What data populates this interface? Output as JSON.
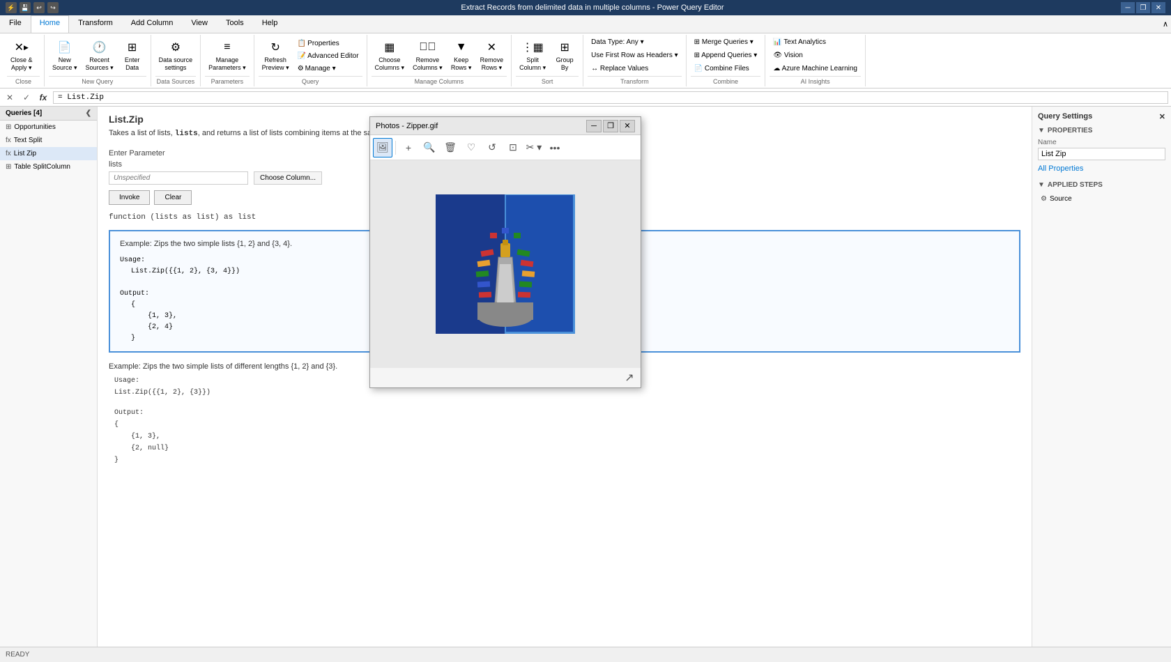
{
  "titlebar": {
    "title": "Extract Records from delimited data in multiple columns - Power Query Editor",
    "icons": [
      "save",
      "undo",
      "redo"
    ],
    "controls": [
      "minimize",
      "restore",
      "close"
    ]
  },
  "ribbon": {
    "tabs": [
      "File",
      "Home",
      "Transform",
      "Add Column",
      "View",
      "Tools",
      "Help"
    ],
    "active_tab": "Home",
    "groups": {
      "close": {
        "label": "Close",
        "buttons": [
          {
            "label": "Close &\nApply",
            "icon": "✕"
          }
        ]
      },
      "query": {
        "label": "New Query",
        "buttons": [
          {
            "label": "New\nSource",
            "icon": "📄"
          },
          {
            "label": "Recent\nSources",
            "icon": "🕐"
          },
          {
            "label": "Enter\nData",
            "icon": "📊"
          }
        ]
      },
      "data_sources": {
        "label": "Data Sources",
        "buttons": [
          {
            "label": "Data source\nsettings",
            "icon": "⚙"
          }
        ]
      },
      "parameters": {
        "label": "Parameters",
        "buttons": [
          {
            "label": "Manage\nParameters",
            "icon": "≡"
          }
        ]
      },
      "query_group": {
        "label": "Query",
        "buttons": [
          {
            "label": "Refresh\nPreview",
            "icon": "↻"
          },
          {
            "label": "Manage ▾",
            "icon": ""
          }
        ]
      },
      "manage_columns": {
        "label": "Manage Columns",
        "buttons": [
          {
            "label": "Choose\nColumns",
            "icon": "▦"
          },
          {
            "label": "Remove\nColumns",
            "icon": "✕"
          },
          {
            "label": "Keep\nRows",
            "icon": "≡"
          },
          {
            "label": "Remove\nRows",
            "icon": "≡"
          }
        ]
      },
      "sort": {
        "label": "Sort",
        "buttons": [
          {
            "label": "Split\nColumn",
            "icon": "⋮"
          },
          {
            "label": "Group\nBy",
            "icon": "⊞"
          }
        ]
      },
      "transform": {
        "label": "Transform",
        "items": [
          "Data Type: Any ▾",
          "Use First Row as Headers ▾",
          "Replace Values"
        ]
      },
      "combine": {
        "label": "Combine",
        "items": [
          "Merge Queries ▾",
          "Append Queries ▾",
          "Combine Files"
        ]
      },
      "ai_insights": {
        "label": "AI Insights",
        "items": [
          "Text Analytics",
          "Vision",
          "Azure Machine Learning"
        ]
      }
    }
  },
  "formula_bar": {
    "check_label": "✓",
    "x_label": "✕",
    "fx_label": "fx",
    "value": "= List.Zip"
  },
  "sidebar": {
    "header": "Queries [4]",
    "items": [
      {
        "label": "Opportunities",
        "icon": "⊞",
        "active": false
      },
      {
        "label": "Text Split",
        "icon": "fx",
        "active": false
      },
      {
        "label": "List Zip",
        "icon": "fx",
        "active": true
      },
      {
        "label": "Table SplitColumn",
        "icon": "⊞",
        "active": false
      }
    ]
  },
  "content": {
    "title": "List.Zip",
    "description": "Takes a list of lists, lists, and returns a list of lists combining items at the same position.",
    "description_code": "lists",
    "param_section": {
      "label": "Enter Parameter",
      "param_name": "lists",
      "param_placeholder": "Unspecified",
      "choose_btn": "Choose Column...",
      "invoke_btn": "Invoke",
      "clear_btn": "Clear"
    },
    "function_sig": "function (lists as list) as list",
    "example1": {
      "header": "Example: Zips the two simple lists {1, 2} and {3, 4}.",
      "usage_label": "Usage:",
      "usage_code": "List.Zip({{1, 2}, {3, 4}})",
      "output_label": "Output:",
      "output_code": "{\n    {1, 3},\n    {2, 4}\n}"
    },
    "example2": {
      "header": "Example: Zips the two simple lists of different lengths {1, 2} and {3}.",
      "usage_label": "Usage:",
      "usage_code": "List.Zip({{1, 2}, {3}})",
      "output_label": "Output:",
      "output_code": "{\n    {1, 3},\n    {2, null}\n}"
    }
  },
  "query_settings": {
    "title": "Query Settings",
    "close_icon": "✕",
    "properties_label": "PROPERTIES",
    "name_label": "Name",
    "name_value": "List Zip",
    "all_properties_link": "All Properties",
    "applied_steps_label": "APPLIED STEPS",
    "steps": [
      {
        "label": "Source",
        "icon": "⚙"
      }
    ]
  },
  "photo_dialog": {
    "title": "Photos - Zipper.gif",
    "controls": [
      "minimize",
      "restore",
      "close"
    ],
    "toolbar_buttons": [
      "🖼",
      "+",
      "🔍",
      "🗑",
      "♡",
      "↺",
      "✂",
      "✂▾",
      "•••"
    ],
    "expand_icon": "↗"
  },
  "status_bar": {
    "text": "READY"
  }
}
